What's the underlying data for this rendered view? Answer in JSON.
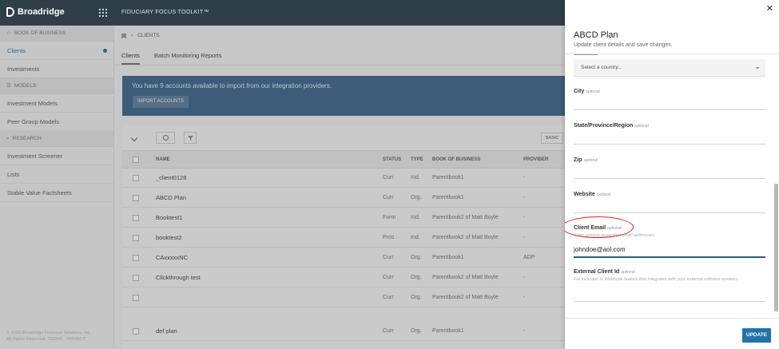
{
  "header": {
    "brand": "Broadridge",
    "app_title": "FIDUCIARY FOCUS TOOLKIT™"
  },
  "sidebar": {
    "sections": [
      {
        "label": "BOOK OF BUSINESS",
        "icon": "star-icon",
        "items": [
          "Clients",
          "Investments"
        ]
      },
      {
        "label": "MODELS",
        "icon": "models-icon",
        "items": [
          "Investment Models",
          "Peer Group Models"
        ]
      },
      {
        "label": "RESEARCH",
        "icon": "search-icon",
        "items": [
          "Investment Screener",
          "Lists",
          "Stable Value Factsheets"
        ]
      }
    ],
    "copyright_line1": "© 2023 Broadridge Financial Solutions, Inc.",
    "copyright_line2": "All Rights Reserved. TERMS · PRIVACY"
  },
  "breadcrumb": "CLIENTS",
  "tabs": [
    "Clients",
    "Batch Monitoring Reports"
  ],
  "banner": {
    "text": "You have 9 accounts available to import from our integration providers.",
    "button": "IMPORT ACCOUNTS"
  },
  "table": {
    "basic_label": "BASIC",
    "columns": [
      "NAME",
      "STATUS",
      "TYPE",
      "BOOK OF BUSINESS",
      "PROVIDER"
    ],
    "rows": [
      {
        "name": "_client0128",
        "status": "Curr",
        "type": "Ind.",
        "book": "Parentbook1",
        "provider": "-"
      },
      {
        "name": "ABCD Plan",
        "status": "Curr",
        "type": "Org.",
        "book": "Parentbook1",
        "provider": "-"
      },
      {
        "name": "Booktest1",
        "status": "Form",
        "type": "Ind.",
        "book": "Parentbook2 of Matt Boyle",
        "provider": "-"
      },
      {
        "name": "booktest2",
        "status": "Pros",
        "type": "Ind.",
        "book": "Parentbook2 of Matt Boyle",
        "provider": "-"
      },
      {
        "name": "CAxxxxxNC",
        "status": "Curr",
        "type": "Org.",
        "book": "Parentbook1",
        "provider": "ADP"
      },
      {
        "name": "Clickthrough test",
        "status": "Curr",
        "type": "Org.",
        "book": "Parentbook2 of Matt Boyle",
        "provider": "-"
      },
      {
        "name": "",
        "status": "Curr",
        "type": "Org.",
        "book": "Parentbook2 of Matt Boyle",
        "provider": "-"
      },
      {
        "name": "def plan",
        "status": "Curr",
        "type": "Org.",
        "book": "Parentbook1",
        "provider": "-"
      }
    ]
  },
  "drawer": {
    "title": "ABCD Plan",
    "subtitle": "Update client details and save changes.",
    "country_placeholder": "Select a country...",
    "optional": "optional",
    "fields": {
      "city": "City",
      "state": "State/Province/Region",
      "zip": "Zip",
      "website": "Website",
      "client_email": "Client Email",
      "client_email_hint": "Enter comma-separated email addresses.",
      "client_email_value": "johndoe@aol.com",
      "external_id": "External Client Id",
      "external_id_hint": "For inclusion in Webhook feature that integrates with your external software systems."
    },
    "update_button": "UPDATE"
  },
  "colors": {
    "topbar": "#2f3f49",
    "banner": "#3d5c79",
    "primary_button": "#2373a8",
    "annotation": "#d81e1e"
  }
}
